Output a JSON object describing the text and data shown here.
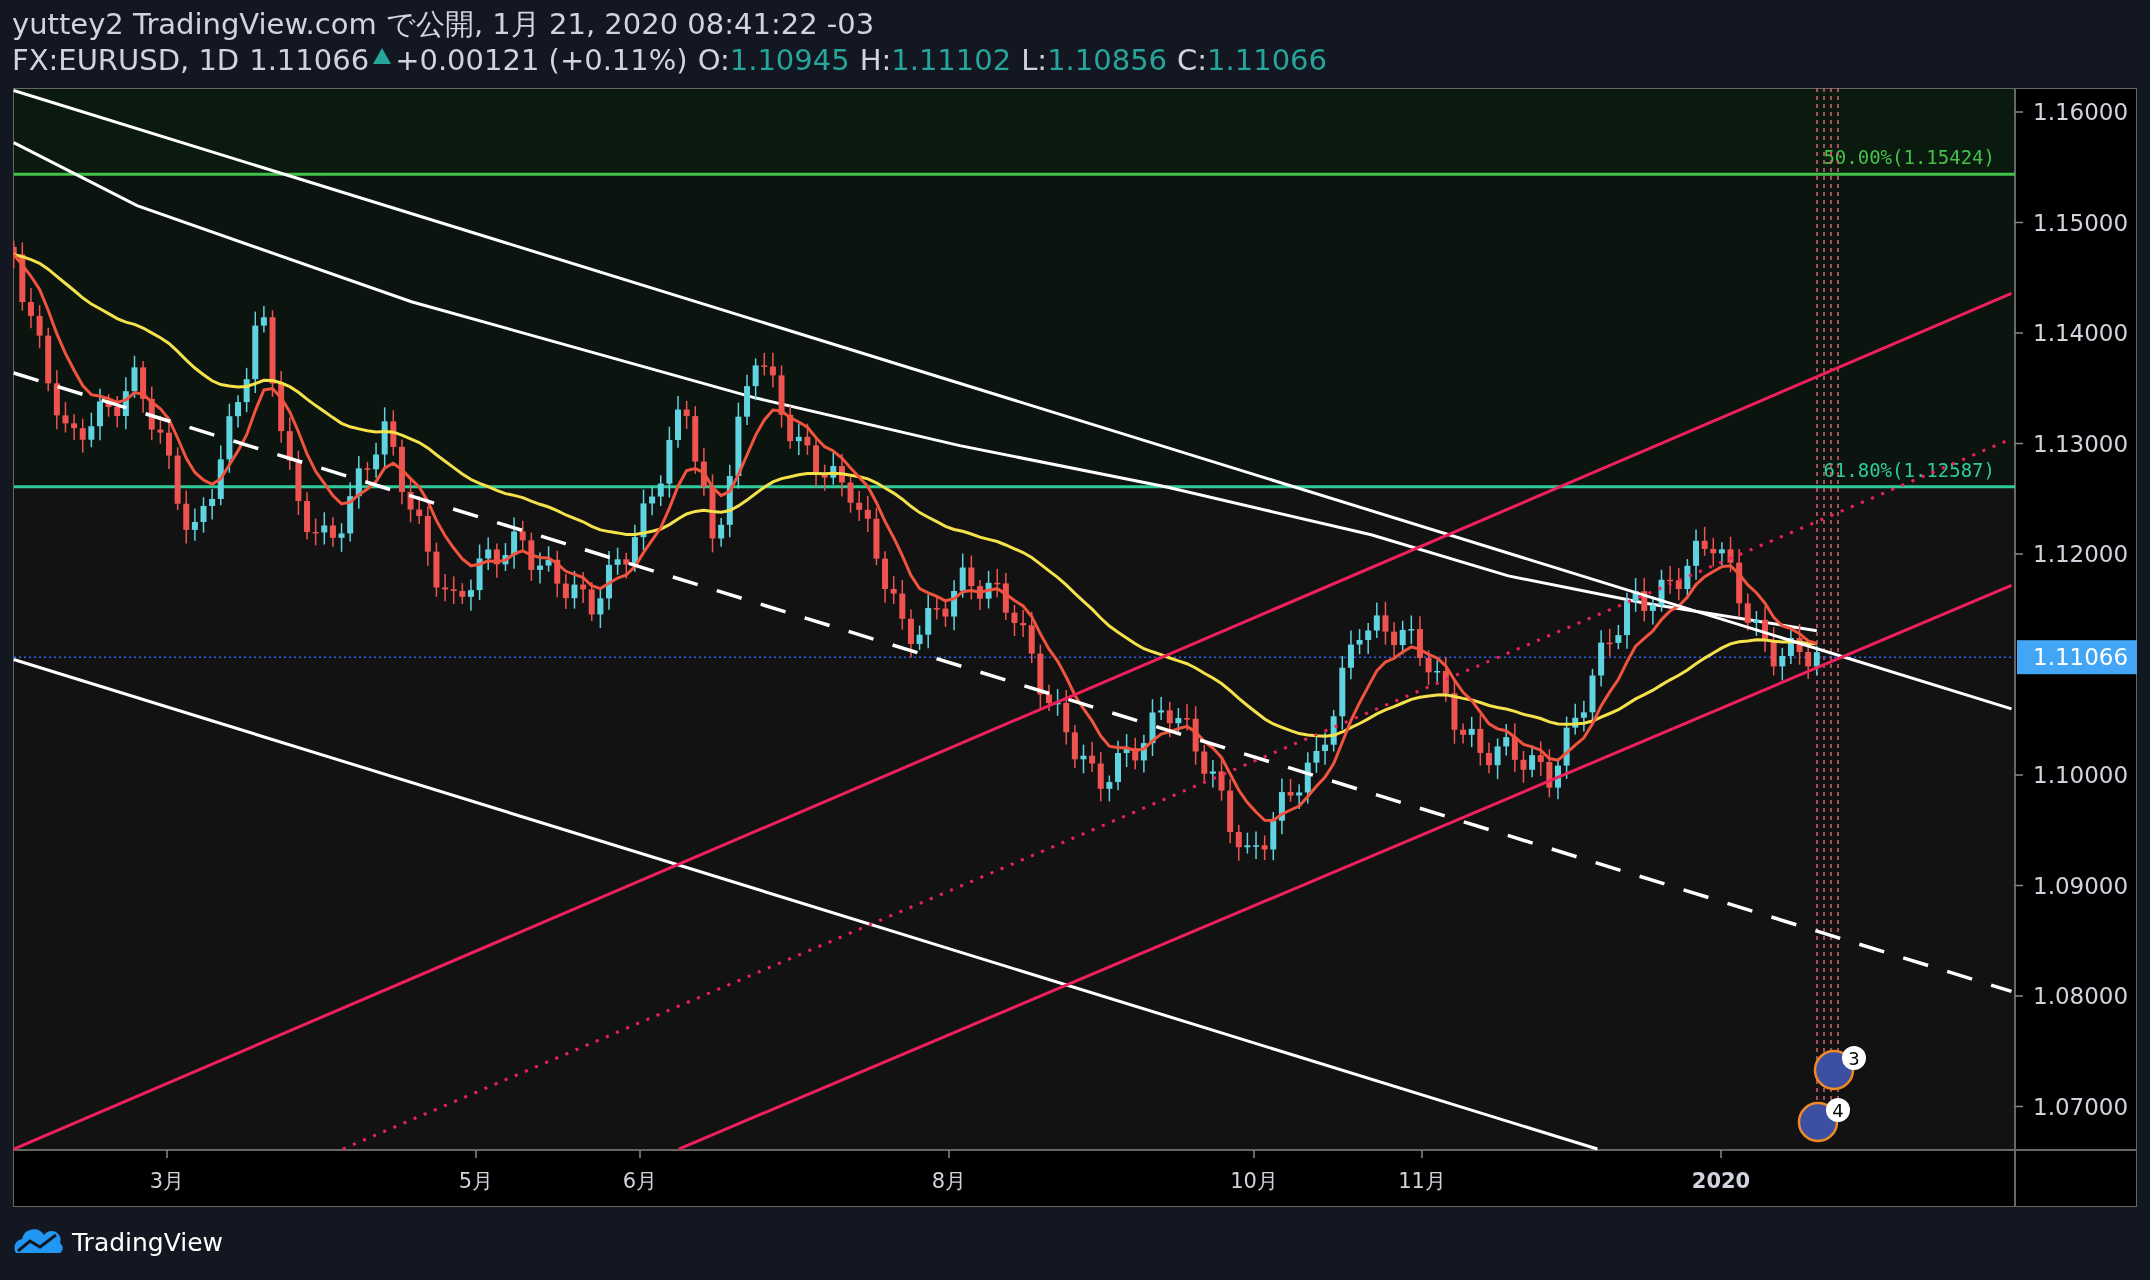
{
  "header": {
    "title": "yuttey2 TradingView.com で公開, 1月 21, 2020 08:41:22 -03",
    "symbol": "FX:EURUSD, 1D",
    "last": "1.11066",
    "change": "+0.00121 (+0.11%)",
    "ohlc": [
      {
        "label": "O:",
        "value": "1.10945"
      },
      {
        "label": "H:",
        "value": "1.11102"
      },
      {
        "label": "L:",
        "value": "1.10856"
      },
      {
        "label": "C:",
        "value": "1.11066"
      }
    ]
  },
  "chart": {
    "fib_levels": [
      {
        "label": "50.00%(1.15424)",
        "color": "#43c24a"
      },
      {
        "label": "61.80%(1.12587)",
        "color": "#2ecc9a"
      }
    ],
    "price_axis": [
      "1.16000",
      "1.15000",
      "1.14000",
      "1.13000",
      "1.12000",
      "1.10000",
      "1.09000",
      "1.08000",
      "1.07000"
    ],
    "current_price": "1.11066",
    "time_axis": [
      {
        "label": "3月",
        "kind": "month"
      },
      {
        "label": "5月",
        "kind": "month"
      },
      {
        "label": "6月",
        "kind": "month"
      },
      {
        "label": "8月",
        "kind": "month"
      },
      {
        "label": "10月",
        "kind": "month"
      },
      {
        "label": "11月",
        "kind": "month"
      },
      {
        "label": "2020",
        "kind": "year"
      }
    ],
    "events": [
      {
        "count": "3"
      },
      {
        "count": "4"
      }
    ]
  },
  "footer": {
    "brand": "TradingView"
  }
}
